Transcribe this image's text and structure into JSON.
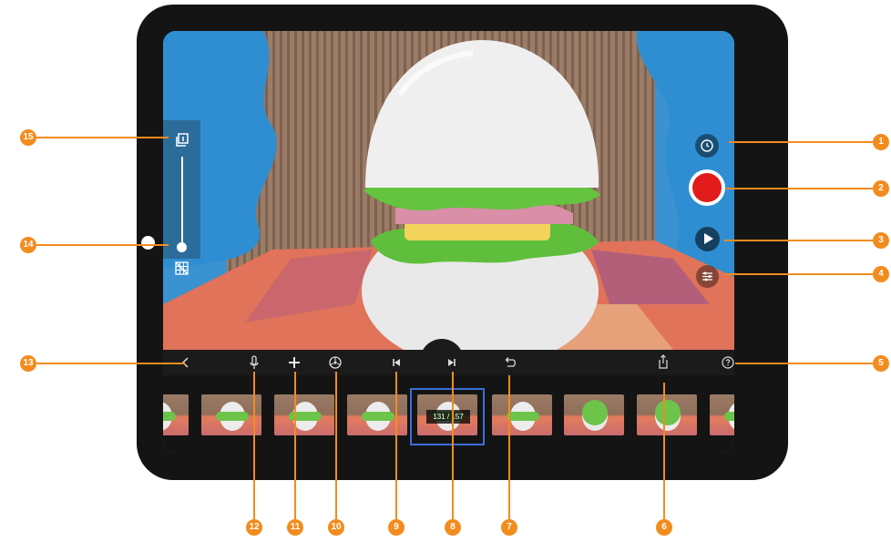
{
  "colors": {
    "accent": "#f28c1e",
    "record": "#e21b1b",
    "selected_frame_border": "#3a6fd8",
    "toolbar": "#1b1b1b"
  },
  "left_panel": {
    "top_icon": "onion-skin-icon",
    "bottom_icon": "grid-off-icon",
    "slider_level": 0.05
  },
  "right_controls": {
    "timer_icon": "timer-icon",
    "record_icon": "record-button",
    "play_icon": "play-icon",
    "adjust_icon": "sliders-icon"
  },
  "toolbar": {
    "back_icon": "chevron-left-icon",
    "mic_icon": "microphone-icon",
    "add_icon": "plus-icon",
    "effects_icon": "film-reel-icon",
    "first_icon": "skip-back-icon",
    "last_icon": "skip-forward-icon",
    "undo_icon": "undo-icon",
    "share_icon": "share-icon",
    "help_icon": "help-icon"
  },
  "filmstrip": {
    "frame_counter": "131 / 157",
    "current_frame": 131,
    "total_frames": 157
  },
  "callouts": [
    "1",
    "2",
    "3",
    "4",
    "5",
    "6",
    "7",
    "8",
    "9",
    "10",
    "11",
    "12",
    "13",
    "14",
    "15"
  ]
}
